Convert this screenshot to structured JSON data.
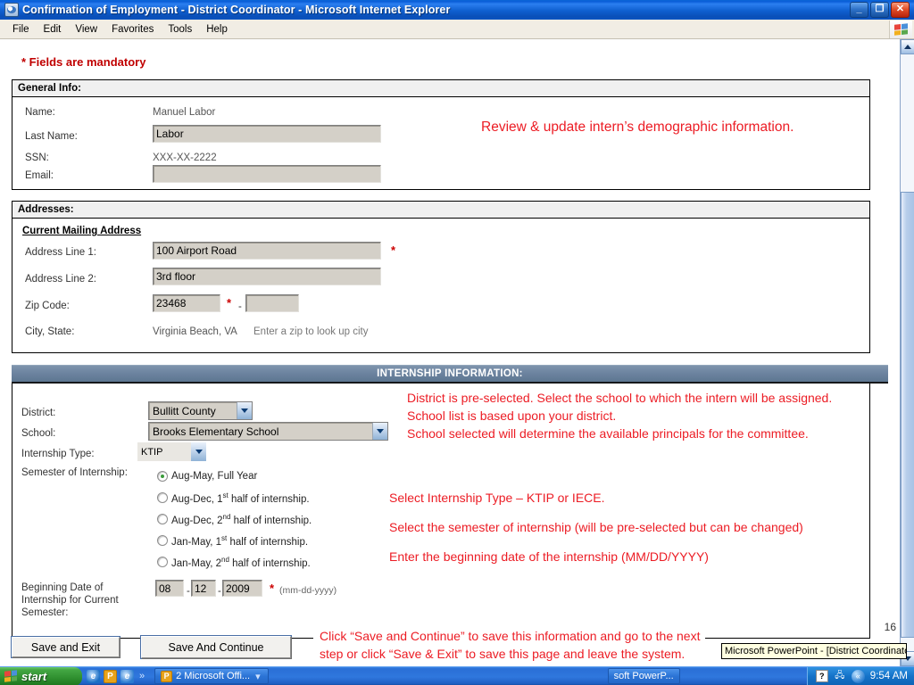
{
  "window": {
    "title": "Confirmation of Employment - District Coordinator - Microsoft Internet Explorer",
    "icon": "ie-document-icon",
    "minimize": "_",
    "restore": "❐",
    "close": "✕"
  },
  "menu": {
    "items": [
      "File",
      "Edit",
      "View",
      "Favorites",
      "Tools",
      "Help"
    ]
  },
  "form": {
    "mandatory_note": "* Fields are mandatory",
    "general": {
      "header": "General Info:",
      "fields": [
        {
          "label": "Name:",
          "value": "Manuel Labor",
          "type": "readonly"
        },
        {
          "label": "Last Name:",
          "value": "Labor",
          "type": "input"
        },
        {
          "label": "SSN:",
          "value": "XXX-XX-2222",
          "type": "readonly"
        },
        {
          "label": "Email:",
          "value": "",
          "type": "input"
        }
      ]
    },
    "addresses": {
      "header": "Addresses:",
      "subheader": "Current Mailing Address",
      "address_line_1": {
        "label": "Address Line 1:",
        "value": "100 Airport Road",
        "required": "*"
      },
      "address_line_2": {
        "label": "Address Line 2:",
        "value": "3rd floor"
      },
      "zip": {
        "label": "Zip Code:",
        "value": "23468",
        "required": "*",
        "separator": "-",
        "plus4": ""
      },
      "city_state": {
        "label": "City, State:",
        "value": "Virginia Beach, VA",
        "hint": "Enter a zip to look up city"
      }
    },
    "internship": {
      "header": "INTERNSHIP INFORMATION:",
      "district": {
        "label": "District:",
        "value": "Bullitt County"
      },
      "school": {
        "label": "School:",
        "value": "Brooks Elementary School"
      },
      "type": {
        "label": "Internship Type:",
        "value": "KTIP"
      },
      "semester": {
        "label": "Semester of Internship:",
        "options": [
          {
            "text": "Aug-May, Full Year",
            "selected": true
          },
          {
            "text": "Aug-Dec, 1st half of internship.",
            "selected": false
          },
          {
            "text": "Aug-Dec, 2nd half of internship.",
            "selected": false
          },
          {
            "text": "Jan-May, 1st half of internship.",
            "selected": false
          },
          {
            "text": "Jan-May, 2nd half of internship.",
            "selected": false
          }
        ]
      },
      "begin_date": {
        "label": "Beginning Date of Internship for Current Semester:",
        "month": "08",
        "day": "12",
        "year": "2009",
        "required": "*",
        "format_hint": "(mm-dd-yyyy)"
      }
    },
    "buttons": {
      "save_exit": "Save and Exit",
      "save_continue": "Save And Continue"
    }
  },
  "annotations": {
    "demographic": "Review & update intern’s demographic information.",
    "district_school": "District is pre-selected. Select the school to which the intern will be assigned. School list is based upon your district.\nSchool selected will determine the available principals for the committee.",
    "type_note": "Select Internship Type – KTIP or IECE.",
    "semester_note": "Select the semester of internship (will be pre-selected but can be changed)",
    "date_note": "Enter the beginning date of the internship (MM/DD/YYYY)",
    "buttons_note": "Click “Save and Continue” to save this information and go to the next step or click “Save & Exit” to save this page and leave the system."
  },
  "slide": {
    "number": "16"
  },
  "tooltip": {
    "text": "Microsoft PowerPoint - [District Coordinator]"
  },
  "taskbar": {
    "start": "start",
    "quick_launch": [
      "ie-icon",
      "powerpoint-icon",
      "ie-alt-icon",
      "more-chevron-icon"
    ],
    "items": [
      {
        "label": "2 Microsoft Offi..."
      },
      {
        "label": "soft PowerP..."
      }
    ],
    "tray": {
      "help": "?",
      "network": "«",
      "clock": "9:54 AM"
    }
  },
  "colors": {
    "accent_red": "#ec1c24",
    "mandatory_red": "#c00000",
    "section_bar": "#6d84a0",
    "titlebar_blue": "#0b5ed8",
    "field_bg": "#d4d0c8"
  }
}
